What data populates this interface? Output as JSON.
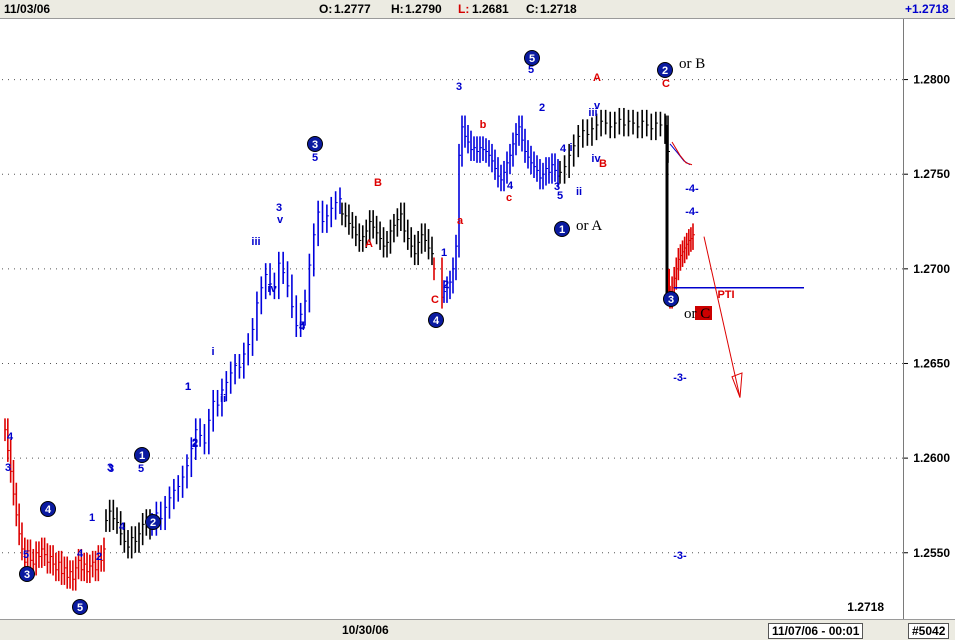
{
  "header": {
    "date": "11/03/06",
    "open_label": "O:",
    "open": "1.2777",
    "high_label": "H:",
    "high": "1.2790",
    "low_label": "L:",
    "low": "1.2681",
    "close_label": "C:",
    "close": "1.2718",
    "change": "+1.2718"
  },
  "footer": {
    "date_tick": "10/30/06",
    "cursor_time": "11/07/06 - 00:01",
    "chart_id": "#5042"
  },
  "colors": {
    "up_bar": "#0000dd",
    "down_bar": "#dd0000",
    "neutral_bar": "#000000",
    "label_blue": "#0000cc",
    "label_red": "#dd0000",
    "grid": "#555555"
  },
  "chart_data": {
    "type": "ohlc",
    "ylim": [
      1.2515,
      1.2832
    ],
    "y_ticks": [
      "1.2800",
      "1.2750",
      "1.2700",
      "1.2650",
      "1.2600",
      "1.2550"
    ],
    "last_price": "1.2718",
    "x_tick": "10/30/06",
    "series": [
      {
        "segment": "red",
        "color": "#dd0000",
        "points": [
          1.2615,
          1.2604,
          1.2593,
          1.2581,
          1.257,
          1.256,
          1.2552,
          1.2545,
          1.2551,
          1.2546,
          1.2544,
          1.255,
          1.2548,
          1.2552,
          1.2549,
          1.2545,
          1.2548,
          1.2544,
          1.2541,
          1.2545,
          1.2539,
          1.2542,
          1.2537,
          1.254,
          1.2536,
          1.2542,
          1.2546,
          1.2541,
          1.2544,
          1.254,
          1.2543,
          1.2545,
          1.2541,
          1.2548,
          1.2546,
          1.2552
        ]
      },
      {
        "segment": "black",
        "color": "#000000",
        "points": [
          1.2567,
          1.2572,
          1.2568,
          1.2566,
          1.256,
          1.2556,
          1.2553,
          1.2558,
          1.2556,
          1.256,
          1.2565,
          1.2567,
          1.2563
        ]
      },
      {
        "segment": "blue_rally",
        "color": "#0000dd",
        "points": [
          1.2565,
          1.2571,
          1.2568,
          1.2574,
          1.2579,
          1.2583,
          1.2585,
          1.259,
          1.2596,
          1.2605,
          1.2615,
          1.2612,
          1.2608,
          1.262,
          1.263,
          1.2628,
          1.2636,
          1.264,
          1.2645,
          1.2649,
          1.2648,
          1.2655,
          1.266,
          1.2668,
          1.2682,
          1.269,
          1.2697,
          1.2692,
          1.269,
          1.2703,
          1.2698,
          1.2691,
          1.268,
          1.267,
          1.2676,
          1.2683,
          1.2702,
          1.2718,
          1.273,
          1.2725,
          1.2728,
          1.2732,
          1.2735,
          1.2737
        ]
      },
      {
        "segment": "black_range",
        "color": "#000000",
        "points": [
          1.2729,
          1.2728,
          1.2724,
          1.2722,
          1.2718,
          1.2715,
          1.2717,
          1.272,
          1.2725,
          1.2722,
          1.2719,
          1.2716,
          1.2712,
          1.2714,
          1.272,
          1.2723,
          1.2726,
          1.2729,
          1.272,
          1.2716,
          1.2712,
          1.2708,
          1.2714,
          1.2718,
          1.2715,
          1.2711,
          1.2708
        ]
      },
      {
        "segment": "red_drop",
        "color": "#dd0000",
        "points": [
          1.27,
          1.2685
        ]
      },
      {
        "segment": "blue_rally2",
        "color": "#0000dd",
        "points": [
          1.2688,
          1.269,
          1.2693,
          1.27,
          1.2712,
          1.276,
          1.2775,
          1.277,
          1.2767,
          1.2763,
          1.2764,
          1.2762,
          1.2764,
          1.2763,
          1.2762,
          1.276,
          1.2757,
          1.2753,
          1.2749,
          1.2747,
          1.2751,
          1.2756,
          1.276,
          1.2766,
          1.2771,
          1.2775,
          1.2768,
          1.2762,
          1.2759,
          1.2756,
          1.2754,
          1.2752,
          1.2748,
          1.275,
          1.2753,
          1.2751,
          1.2755,
          1.2752,
          1.2749
        ]
      },
      {
        "segment": "black_top",
        "color": "#000000",
        "points": [
          1.2751,
          1.2754,
          1.276,
          1.2765,
          1.277,
          1.2773,
          1.2771,
          1.2774,
          1.2776,
          1.2778,
          1.2777,
          1.2775,
          1.2777,
          1.2779,
          1.2776,
          1.2778,
          1.2777,
          1.2775,
          1.2778,
          1.2776,
          1.2774,
          1.2777,
          1.2776,
          1.2772
        ]
      },
      {
        "segment": "drop",
        "color": "#000000",
        "points": [
          1.2775,
          1.2762
        ]
      },
      {
        "segment": "red_recovery",
        "color": "#dd0000",
        "points": [
          1.2685,
          1.269,
          1.2695,
          1.27,
          1.2705,
          1.2707,
          1.2709,
          1.2711,
          1.2713,
          1.2715,
          1.2716,
          1.2718
        ]
      }
    ],
    "annotations": [
      {
        "text": "4",
        "color": "blue"
      },
      {
        "text": "3",
        "color": "blue"
      },
      {
        "text": "5",
        "color": "blue"
      },
      {
        "text": "4",
        "color": "blue"
      },
      {
        "text": "2",
        "color": "blue"
      },
      {
        "text": "1",
        "color": "blue"
      },
      {
        "text": "3",
        "color": "blue"
      },
      {
        "text": "5",
        "color": "blue"
      },
      {
        "text": "2",
        "color": "blue"
      },
      {
        "text": "1",
        "color": "blue"
      },
      {
        "text": "3",
        "color": "blue"
      },
      {
        "text": "4",
        "color": "blue"
      },
      {
        "text": "5",
        "color": "blue"
      },
      {
        "text": "1",
        "color": "blue"
      },
      {
        "text": "2",
        "color": "blue"
      },
      {
        "text": "i",
        "color": "blue"
      },
      {
        "text": "ii",
        "color": "blue"
      },
      {
        "text": "iii",
        "color": "blue"
      },
      {
        "text": "iv",
        "color": "blue"
      },
      {
        "text": "3",
        "color": "blue"
      },
      {
        "text": "v",
        "color": "blue"
      },
      {
        "text": "4",
        "color": "blue"
      },
      {
        "text": "5",
        "color": "blue"
      },
      {
        "text": "A",
        "color": "red"
      },
      {
        "text": "B",
        "color": "red"
      },
      {
        "text": "C",
        "color": "red"
      },
      {
        "text": "1",
        "color": "blue"
      },
      {
        "text": "2",
        "color": "blue"
      },
      {
        "text": "a",
        "color": "red"
      },
      {
        "text": "3",
        "color": "blue"
      },
      {
        "text": "b",
        "color": "red"
      },
      {
        "text": "c",
        "color": "red"
      },
      {
        "text": "4",
        "color": "blue"
      },
      {
        "text": "2",
        "color": "blue"
      },
      {
        "text": "5",
        "color": "blue"
      },
      {
        "text": "A",
        "color": "red"
      },
      {
        "text": "i",
        "color": "blue"
      },
      {
        "text": "3",
        "color": "blue"
      },
      {
        "text": "5",
        "color": "blue"
      },
      {
        "text": "ii",
        "color": "blue"
      },
      {
        "text": "iii",
        "color": "blue"
      },
      {
        "text": "v",
        "color": "blue"
      },
      {
        "text": "iv",
        "color": "blue"
      },
      {
        "text": "B",
        "color": "red"
      },
      {
        "text": "C",
        "color": "red"
      },
      {
        "text": "4",
        "color": "blue"
      },
      {
        "text": "-4-",
        "color": "blue"
      },
      {
        "text": "-4-",
        "color": "blue"
      },
      {
        "text": "-3-",
        "color": "blue"
      },
      {
        "text": "-3-",
        "color": "blue"
      },
      {
        "text": "84",
        "color": "red"
      },
      {
        "text": "PTI",
        "color": "red"
      },
      {
        "text": "or B",
        "color": "black"
      },
      {
        "text": "or A",
        "color": "black"
      },
      {
        "text": "or C",
        "color": "black"
      }
    ],
    "circled_labels": [
      "3",
      "4",
      "5",
      "1",
      "2",
      "3",
      "4",
      "5",
      "1",
      "2",
      "3"
    ],
    "projection_target": 1.269
  }
}
